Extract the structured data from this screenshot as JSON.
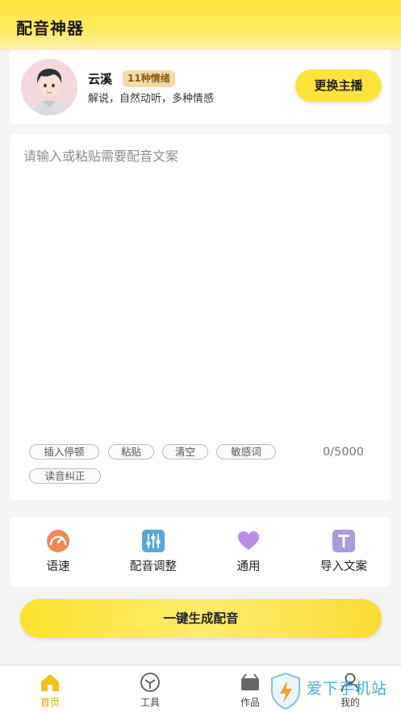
{
  "header": {
    "title": "配音神器"
  },
  "anchor": {
    "name": "云溪",
    "emotion_badge": "11种情绪",
    "description": "解说，自然动听，多种情感",
    "switch_label": "更换主播"
  },
  "editor": {
    "placeholder": "请输入或粘贴需要配音文案",
    "char_count": "0/5000",
    "actions": [
      {
        "label": "插入停顿"
      },
      {
        "label": "粘贴"
      },
      {
        "label": "清空"
      },
      {
        "label": "敏感词"
      },
      {
        "label": "读音纠正"
      }
    ]
  },
  "tools": [
    {
      "label": "语速",
      "icon": "speedometer-icon",
      "color": "#f08a55"
    },
    {
      "label": "配音调整",
      "icon": "equalizer-icon",
      "color": "#5aa6dc"
    },
    {
      "label": "通用",
      "icon": "heart-icon",
      "color": "#b98de6"
    },
    {
      "label": "导入文案",
      "icon": "text-import-icon",
      "color": "#a99adf"
    }
  ],
  "generate_label": "一键生成配音",
  "bottom_nav": [
    {
      "label": "首页",
      "icon": "home-icon",
      "active": true
    },
    {
      "label": "工具",
      "icon": "box-icon",
      "active": false
    },
    {
      "label": "作品",
      "icon": "works-icon",
      "active": false
    },
    {
      "label": "我的",
      "icon": "user-icon",
      "active": false
    }
  ],
  "watermark": {
    "text": "爱下手机站"
  },
  "colors": {
    "accent": "#fde43b",
    "active_nav": "#d8a800"
  }
}
